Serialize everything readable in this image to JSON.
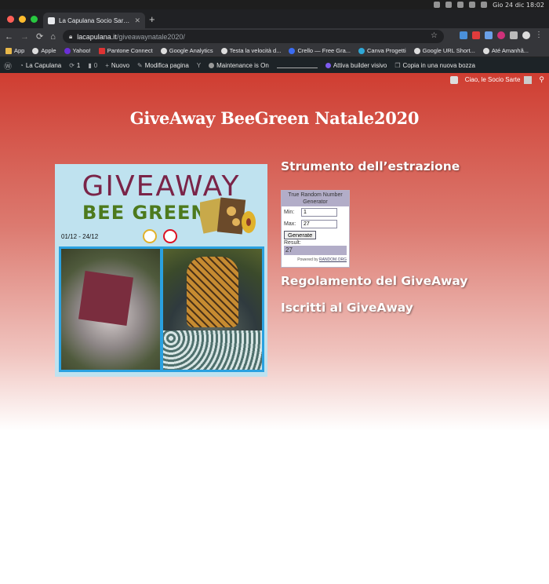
{
  "menubar": {
    "datetime": "Gio 24 dic  18:02"
  },
  "browser": {
    "tab_title": "La Capulana Socio Sartoria - B",
    "tab_close": "✕",
    "newtab": "+",
    "url_host": "lacapulana.it",
    "url_path": "/giveawaynatale2020/",
    "bookmarks": [
      "App",
      "Apple",
      "Yahoo!",
      "Pantone Connect",
      "Google Analytics",
      "Testa la velocità d...",
      "Crello — Free Gra...",
      "Canva Progetti",
      "Google URL Short...",
      "Até Amanhã..."
    ]
  },
  "adminbar": {
    "site": "La Capulana",
    "updates": "1",
    "comments": "0",
    "new": "Nuovo",
    "edit": "Modifica pagina",
    "maintenance": "Maintenance is On",
    "builder": "Attiva builder visivo",
    "copy": "Copia in una nuova bozza",
    "greeting": "Ciao, le Socio Sarte"
  },
  "page": {
    "title": "GiveAway BeeGreen Natale2020",
    "poster": {
      "line1": "GIVEAWAY",
      "line2": "BEE GREEN",
      "dates": "01/12 - 24/12"
    },
    "draw_heading": "Strumento dell’estrazione",
    "rules_heading": "Regolamento del GiveAway",
    "entrants_heading": "Iscritti al GiveAway",
    "rng": {
      "header": "True Random Number Generator",
      "min_label": "Min:",
      "min_value": "1",
      "max_label": "Max:",
      "max_value": "27",
      "button": "Generate",
      "result_label": "Result:",
      "result_value": "27",
      "powered_prefix": "Powered by",
      "powered_link": "RANDOM.ORG"
    }
  }
}
